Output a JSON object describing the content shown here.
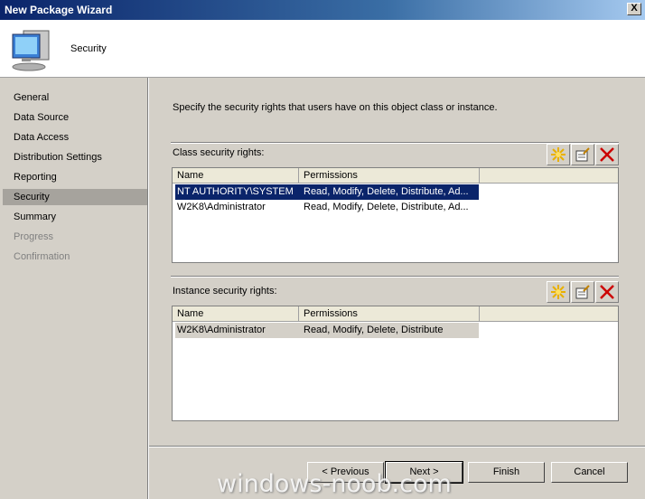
{
  "window": {
    "title": "New Package Wizard",
    "close_glyph": "X"
  },
  "header": {
    "title": "Security",
    "icon": "computer-icon"
  },
  "sidebar": {
    "items": [
      {
        "label": "General",
        "state": "normal"
      },
      {
        "label": "Data Source",
        "state": "normal"
      },
      {
        "label": "Data Access",
        "state": "normal"
      },
      {
        "label": "Distribution Settings",
        "state": "normal"
      },
      {
        "label": "Reporting",
        "state": "normal"
      },
      {
        "label": "Security",
        "state": "selected"
      },
      {
        "label": "Summary",
        "state": "normal"
      },
      {
        "label": "Progress",
        "state": "disabled"
      },
      {
        "label": "Confirmation",
        "state": "disabled"
      }
    ]
  },
  "main": {
    "intro": "Specify the security rights that users have on this object class or instance.",
    "class_rights": {
      "label": "Class security rights:",
      "columns": [
        "Name",
        "Permissions"
      ],
      "rows": [
        {
          "name": "NT AUTHORITY\\SYSTEM",
          "permissions": "Read, Modify, Delete, Distribute, Ad..."
        },
        {
          "name": "W2K8\\Administrator",
          "permissions": "Read, Modify, Delete, Distribute, Ad..."
        }
      ]
    },
    "instance_rights": {
      "label": "Instance security rights:",
      "columns": [
        "Name",
        "Permissions"
      ],
      "rows": [
        {
          "name": "W2K8\\Administrator",
          "permissions": "Read, Modify, Delete, Distribute"
        }
      ]
    }
  },
  "buttons": {
    "previous": "< Previous",
    "next": "Next >",
    "finish": "Finish",
    "cancel": "Cancel"
  },
  "watermark": "windows-noob.com",
  "colors": {
    "selection": "#0a246a",
    "dialog_bg": "#d4d0c8",
    "delete_icon": "#cc0000"
  }
}
